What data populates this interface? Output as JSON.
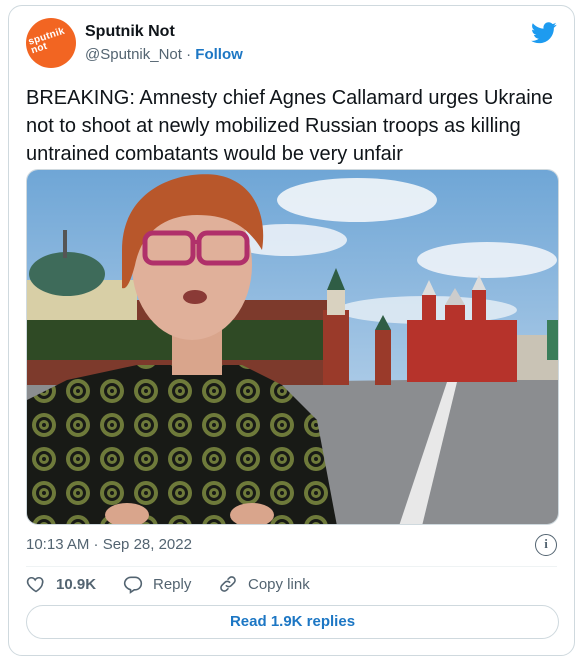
{
  "header": {
    "avatar_text": "sputnik not",
    "display_name": "Sputnik Not",
    "handle": "@Sputnik_Not",
    "separator": " · ",
    "follow_label": "Follow"
  },
  "tweet": {
    "text": "BREAKING: Amnesty chief Agnes Callamard urges Ukraine not to shoot at newly mobilized Russian troops as killing untrained combatants would be very unfair",
    "timestamp": "10:13 AM · Sep 28, 2022"
  },
  "actions": {
    "like_count": "10.9K",
    "reply_label": "Reply",
    "copy_link_label": "Copy link"
  },
  "replies_button": "Read 1.9K replies",
  "colors": {
    "link_blue": "#1d77c4",
    "twitter_blue": "#1d9bf0",
    "avatar_orange": "#f26522",
    "muted_gray": "#536471"
  },
  "icons": [
    "twitter-bird-icon",
    "info-icon",
    "heart-icon",
    "reply-bubble-icon",
    "link-icon"
  ]
}
